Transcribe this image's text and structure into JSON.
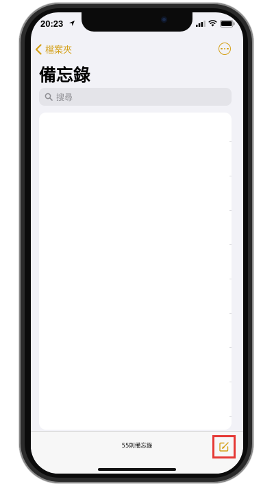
{
  "status": {
    "time": "20:23"
  },
  "nav": {
    "back_label": "檔案夾"
  },
  "page": {
    "title": "備忘錄"
  },
  "search": {
    "placeholder": "搜尋"
  },
  "toolbar": {
    "count_text": "55則備忘錄"
  },
  "colors": {
    "accent": "#d4a017",
    "highlight": "#e53935",
    "background": "#f2f2f7"
  },
  "icons": {
    "back": "chevron-left-icon",
    "more": "ellipsis-circle-icon",
    "search": "magnifier-icon",
    "compose": "compose-icon"
  }
}
